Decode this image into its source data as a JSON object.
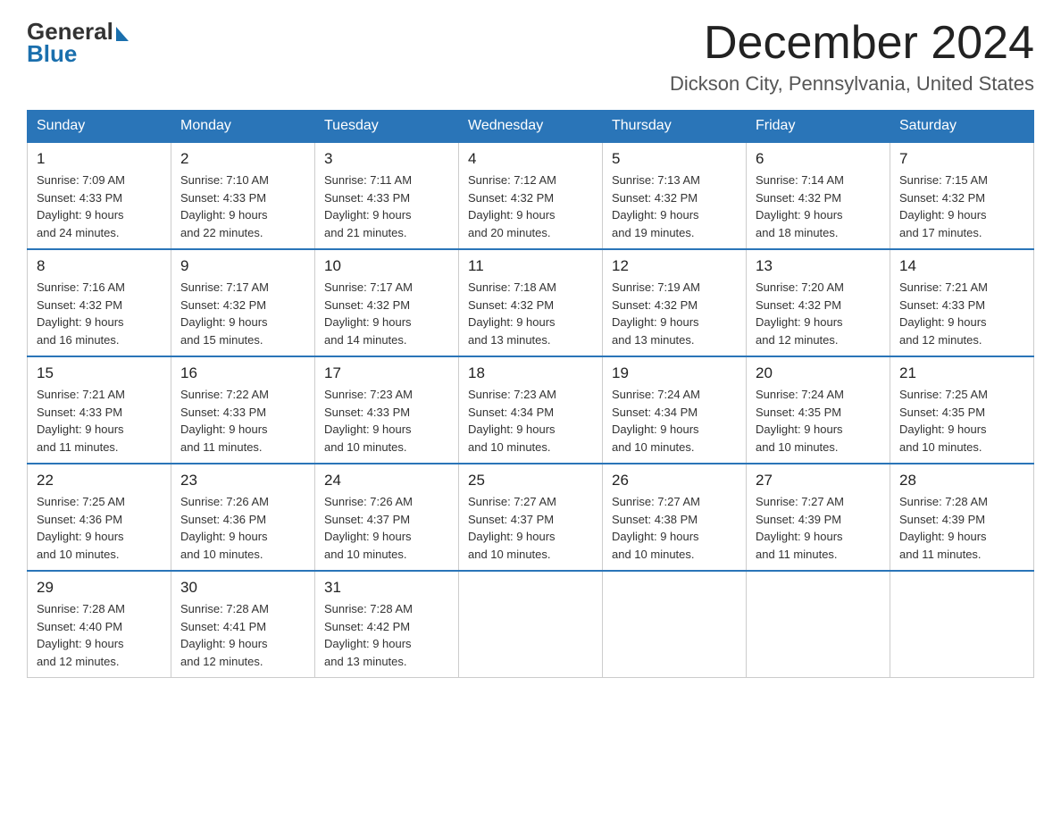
{
  "header": {
    "logo_general": "General",
    "logo_blue": "Blue",
    "month_title": "December 2024",
    "location": "Dickson City, Pennsylvania, United States"
  },
  "days_of_week": [
    "Sunday",
    "Monday",
    "Tuesday",
    "Wednesday",
    "Thursday",
    "Friday",
    "Saturday"
  ],
  "weeks": [
    [
      {
        "day": "1",
        "sunrise": "7:09 AM",
        "sunset": "4:33 PM",
        "daylight": "9 hours and 24 minutes."
      },
      {
        "day": "2",
        "sunrise": "7:10 AM",
        "sunset": "4:33 PM",
        "daylight": "9 hours and 22 minutes."
      },
      {
        "day": "3",
        "sunrise": "7:11 AM",
        "sunset": "4:33 PM",
        "daylight": "9 hours and 21 minutes."
      },
      {
        "day": "4",
        "sunrise": "7:12 AM",
        "sunset": "4:32 PM",
        "daylight": "9 hours and 20 minutes."
      },
      {
        "day": "5",
        "sunrise": "7:13 AM",
        "sunset": "4:32 PM",
        "daylight": "9 hours and 19 minutes."
      },
      {
        "day": "6",
        "sunrise": "7:14 AM",
        "sunset": "4:32 PM",
        "daylight": "9 hours and 18 minutes."
      },
      {
        "day": "7",
        "sunrise": "7:15 AM",
        "sunset": "4:32 PM",
        "daylight": "9 hours and 17 minutes."
      }
    ],
    [
      {
        "day": "8",
        "sunrise": "7:16 AM",
        "sunset": "4:32 PM",
        "daylight": "9 hours and 16 minutes."
      },
      {
        "day": "9",
        "sunrise": "7:17 AM",
        "sunset": "4:32 PM",
        "daylight": "9 hours and 15 minutes."
      },
      {
        "day": "10",
        "sunrise": "7:17 AM",
        "sunset": "4:32 PM",
        "daylight": "9 hours and 14 minutes."
      },
      {
        "day": "11",
        "sunrise": "7:18 AM",
        "sunset": "4:32 PM",
        "daylight": "9 hours and 13 minutes."
      },
      {
        "day": "12",
        "sunrise": "7:19 AM",
        "sunset": "4:32 PM",
        "daylight": "9 hours and 13 minutes."
      },
      {
        "day": "13",
        "sunrise": "7:20 AM",
        "sunset": "4:32 PM",
        "daylight": "9 hours and 12 minutes."
      },
      {
        "day": "14",
        "sunrise": "7:21 AM",
        "sunset": "4:33 PM",
        "daylight": "9 hours and 12 minutes."
      }
    ],
    [
      {
        "day": "15",
        "sunrise": "7:21 AM",
        "sunset": "4:33 PM",
        "daylight": "9 hours and 11 minutes."
      },
      {
        "day": "16",
        "sunrise": "7:22 AM",
        "sunset": "4:33 PM",
        "daylight": "9 hours and 11 minutes."
      },
      {
        "day": "17",
        "sunrise": "7:23 AM",
        "sunset": "4:33 PM",
        "daylight": "9 hours and 10 minutes."
      },
      {
        "day": "18",
        "sunrise": "7:23 AM",
        "sunset": "4:34 PM",
        "daylight": "9 hours and 10 minutes."
      },
      {
        "day": "19",
        "sunrise": "7:24 AM",
        "sunset": "4:34 PM",
        "daylight": "9 hours and 10 minutes."
      },
      {
        "day": "20",
        "sunrise": "7:24 AM",
        "sunset": "4:35 PM",
        "daylight": "9 hours and 10 minutes."
      },
      {
        "day": "21",
        "sunrise": "7:25 AM",
        "sunset": "4:35 PM",
        "daylight": "9 hours and 10 minutes."
      }
    ],
    [
      {
        "day": "22",
        "sunrise": "7:25 AM",
        "sunset": "4:36 PM",
        "daylight": "9 hours and 10 minutes."
      },
      {
        "day": "23",
        "sunrise": "7:26 AM",
        "sunset": "4:36 PM",
        "daylight": "9 hours and 10 minutes."
      },
      {
        "day": "24",
        "sunrise": "7:26 AM",
        "sunset": "4:37 PM",
        "daylight": "9 hours and 10 minutes."
      },
      {
        "day": "25",
        "sunrise": "7:27 AM",
        "sunset": "4:37 PM",
        "daylight": "9 hours and 10 minutes."
      },
      {
        "day": "26",
        "sunrise": "7:27 AM",
        "sunset": "4:38 PM",
        "daylight": "9 hours and 10 minutes."
      },
      {
        "day": "27",
        "sunrise": "7:27 AM",
        "sunset": "4:39 PM",
        "daylight": "9 hours and 11 minutes."
      },
      {
        "day": "28",
        "sunrise": "7:28 AM",
        "sunset": "4:39 PM",
        "daylight": "9 hours and 11 minutes."
      }
    ],
    [
      {
        "day": "29",
        "sunrise": "7:28 AM",
        "sunset": "4:40 PM",
        "daylight": "9 hours and 12 minutes."
      },
      {
        "day": "30",
        "sunrise": "7:28 AM",
        "sunset": "4:41 PM",
        "daylight": "9 hours and 12 minutes."
      },
      {
        "day": "31",
        "sunrise": "7:28 AM",
        "sunset": "4:42 PM",
        "daylight": "9 hours and 13 minutes."
      },
      null,
      null,
      null,
      null
    ]
  ],
  "labels": {
    "sunrise": "Sunrise:",
    "sunset": "Sunset:",
    "daylight": "Daylight:"
  }
}
